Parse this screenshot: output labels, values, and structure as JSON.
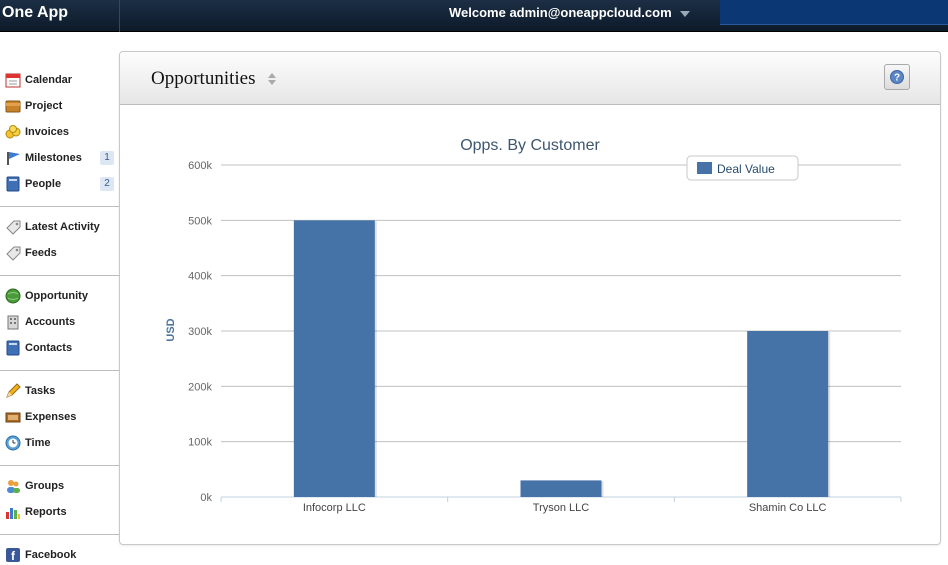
{
  "app": {
    "brand": "One App",
    "welcome": "Welcome admin@oneappcloud.com"
  },
  "sidebar": {
    "groups": [
      [
        {
          "label": "Calendar",
          "icon": "calendar-icon",
          "badge": ""
        },
        {
          "label": "Project",
          "icon": "folder-icon",
          "badge": ""
        },
        {
          "label": "Invoices",
          "icon": "coins-icon",
          "badge": ""
        },
        {
          "label": "Milestones",
          "icon": "flag-icon",
          "badge": "1"
        },
        {
          "label": "People",
          "icon": "book-icon",
          "badge": "2"
        }
      ],
      [
        {
          "label": "Latest Activity",
          "icon": "tag-icon",
          "badge": ""
        },
        {
          "label": "Feeds",
          "icon": "tag-icon",
          "badge": ""
        }
      ],
      [
        {
          "label": "Opportunity",
          "icon": "globe-icon",
          "badge": ""
        },
        {
          "label": "Accounts",
          "icon": "building-icon",
          "badge": ""
        },
        {
          "label": "Contacts",
          "icon": "book-icon",
          "badge": ""
        }
      ],
      [
        {
          "label": "Tasks",
          "icon": "pencil-icon",
          "badge": ""
        },
        {
          "label": "Expenses",
          "icon": "cash-icon",
          "badge": ""
        },
        {
          "label": "Time",
          "icon": "clock-icon",
          "badge": ""
        }
      ],
      [
        {
          "label": "Groups",
          "icon": "users-icon",
          "badge": ""
        },
        {
          "label": "Reports",
          "icon": "bar-chart-icon",
          "badge": ""
        }
      ],
      [
        {
          "label": "Facebook",
          "icon": "facebook-icon",
          "badge": ""
        }
      ]
    ]
  },
  "panel": {
    "title": "Opportunities"
  },
  "colors": {
    "bar": "#4572a7",
    "grid": "#c0c0c0",
    "title": "#3e576f",
    "axis": "#666666"
  },
  "chart_data": {
    "type": "bar",
    "title": "Opps. By Customer",
    "xlabel": "",
    "ylabel": "USD",
    "categories": [
      "Infocorp LLC",
      "Tryson LLC",
      "Shamin Co LLC"
    ],
    "series": [
      {
        "name": "Deal Value",
        "values": [
          500000,
          30000,
          300000
        ]
      }
    ],
    "ylim": [
      0,
      600000
    ],
    "yticks": [
      0,
      100000,
      200000,
      300000,
      400000,
      500000,
      600000
    ],
    "ytick_labels": [
      "0k",
      "100k",
      "200k",
      "300k",
      "400k",
      "500k",
      "600k"
    ],
    "grid": true,
    "legend": "top-right"
  }
}
